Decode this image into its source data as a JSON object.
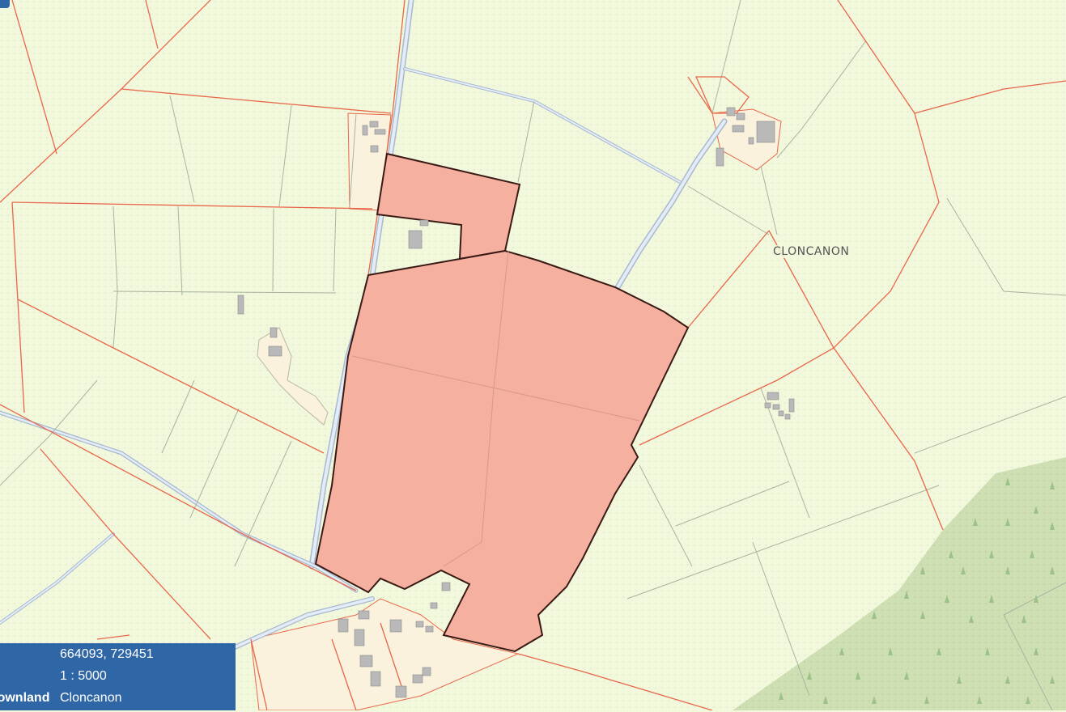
{
  "map": {
    "townland_label": "CLONCANON",
    "selected_parcel_fill": "#f5b0a0",
    "selected_parcel_outline": "#3a1a14",
    "boundary_color": "#e8674a",
    "field_line_color": "#a8b4a0",
    "road_color": "#c8d6e8",
    "forest_color": "#cfdfb4",
    "background_color": "#f2f8dc"
  },
  "info_panel": {
    "coordinates_label": "",
    "coordinates_value": "664093, 729451",
    "scale_label": "",
    "scale_value": "1 : 5000",
    "townland_label": "Townland",
    "townland_value": "Cloncanon"
  }
}
